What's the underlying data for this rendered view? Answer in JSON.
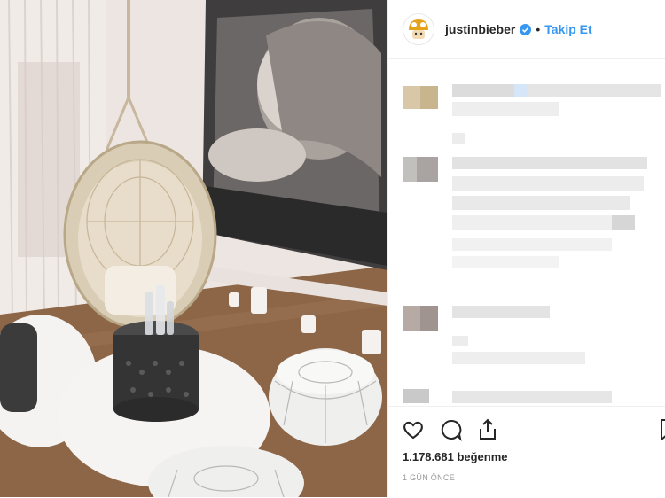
{
  "post": {
    "username": "justinbieber",
    "separator": "•",
    "follow_label": "Takip Et",
    "likes_text": "1.178.681 beğenme",
    "time_ago": "1 GÜN ÖNCE"
  },
  "icons": {
    "like": "heart-outline-icon",
    "comment": "speech-bubble-icon",
    "share": "share-upload-icon",
    "save": "bookmark-icon",
    "verified": "verified-badge-icon"
  },
  "colors": {
    "accent": "#3897f0",
    "text": "#262626",
    "muted": "#999999"
  }
}
